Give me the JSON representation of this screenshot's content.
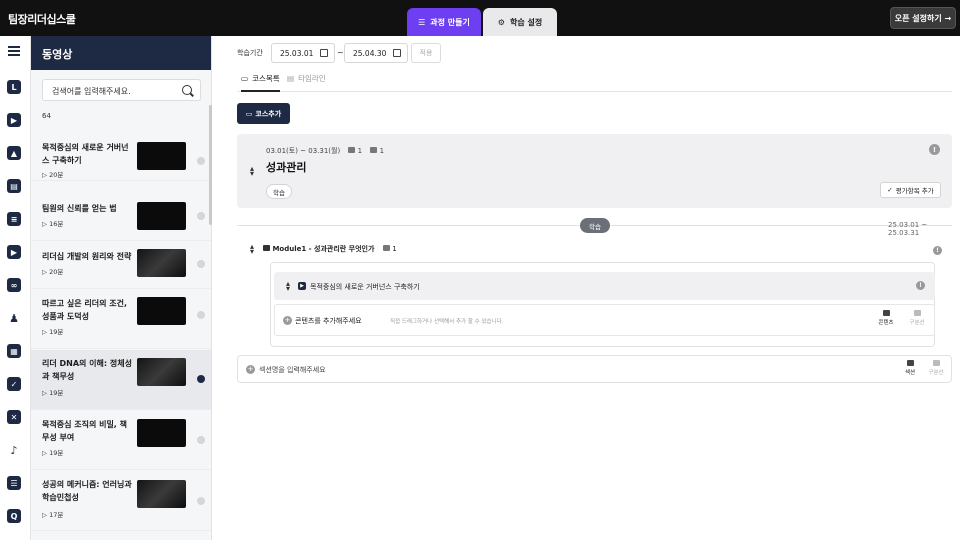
{
  "header": {
    "brand": "팀장리더십스쿨",
    "tabs": [
      {
        "label": "과정 만들기",
        "icon": "layers-icon",
        "active": true
      },
      {
        "label": "학습 설정",
        "icon": "gear-icon",
        "active": false
      }
    ],
    "open_button": "오픈 설정하기 →"
  },
  "rail": {
    "icons": [
      "menu-icon",
      "L",
      "play-icon",
      "image-icon",
      "book-icon",
      "document-icon",
      "play-icon",
      "link-icon",
      "users-icon",
      "calendar-icon",
      "clipboard-check-icon",
      "image-compare-icon",
      "audio-person-icon",
      "list-icon",
      "Q"
    ]
  },
  "panel": {
    "title": "동영상",
    "search_placeholder": "검색어를 입력해주세요.",
    "count": "64",
    "items": [
      {
        "title": "목적중심의 새로운 거버넌스 구축하기",
        "duration": "▷ 20분"
      },
      {
        "title": "팀원의 신뢰를 얻는 법",
        "duration": "▷ 16분"
      },
      {
        "title": "리더십 개발의 원리와 전략",
        "duration": "▷ 20분"
      },
      {
        "title": "따르고 싶은 리더의 조건, 성품과 도덕성",
        "duration": "▷ 19분"
      },
      {
        "title": "리더 DNA의 이해: 정체성과 책무성",
        "duration": "▷ 19분"
      },
      {
        "title": "목적중심 조직의 비밀, 책무성 부여",
        "duration": "▷ 19분"
      },
      {
        "title": "성공의 메커니즘: 언러닝과 학습민첩성",
        "duration": "▷ 17분"
      }
    ]
  },
  "main": {
    "date_label": "학습기간",
    "start_date": "25.03.01",
    "end_date": "25.04.30",
    "tilde": "~",
    "apply_label": "적용",
    "tabs": [
      {
        "label": "코스목록",
        "active": true
      },
      {
        "label": "타임라인",
        "active": false
      }
    ],
    "add_course_label": "코스추가",
    "course": {
      "dates": "03.01(토) ~ 03.31(월)",
      "c1": "1",
      "c2": "1",
      "title": "성과관리",
      "tag": "학습",
      "eval_label": "평가항목 추가"
    },
    "divider_pill": "학습",
    "divider_range": "25.03.01 ~ 25.03.31",
    "module": {
      "title": "Module1 - 성과관리란 무엇인가",
      "count": "1"
    },
    "content_item": "목적중심의 새로운 거버넌스 구축하기",
    "add_content": {
      "label": "콘텐츠를 추가해주세요",
      "hint": "직접 드래그하거나 선택해서 추가 할 수 있습니다.",
      "btn1": "콘텐츠",
      "btn2": "구분선"
    },
    "add_section": {
      "placeholder": "섹션명을 입력해주세요",
      "btn1": "섹션",
      "btn2": "구분선"
    }
  },
  "colors": {
    "accent": "#6d3ff0",
    "navy": "#1e2a44",
    "topbar": "#111111"
  }
}
